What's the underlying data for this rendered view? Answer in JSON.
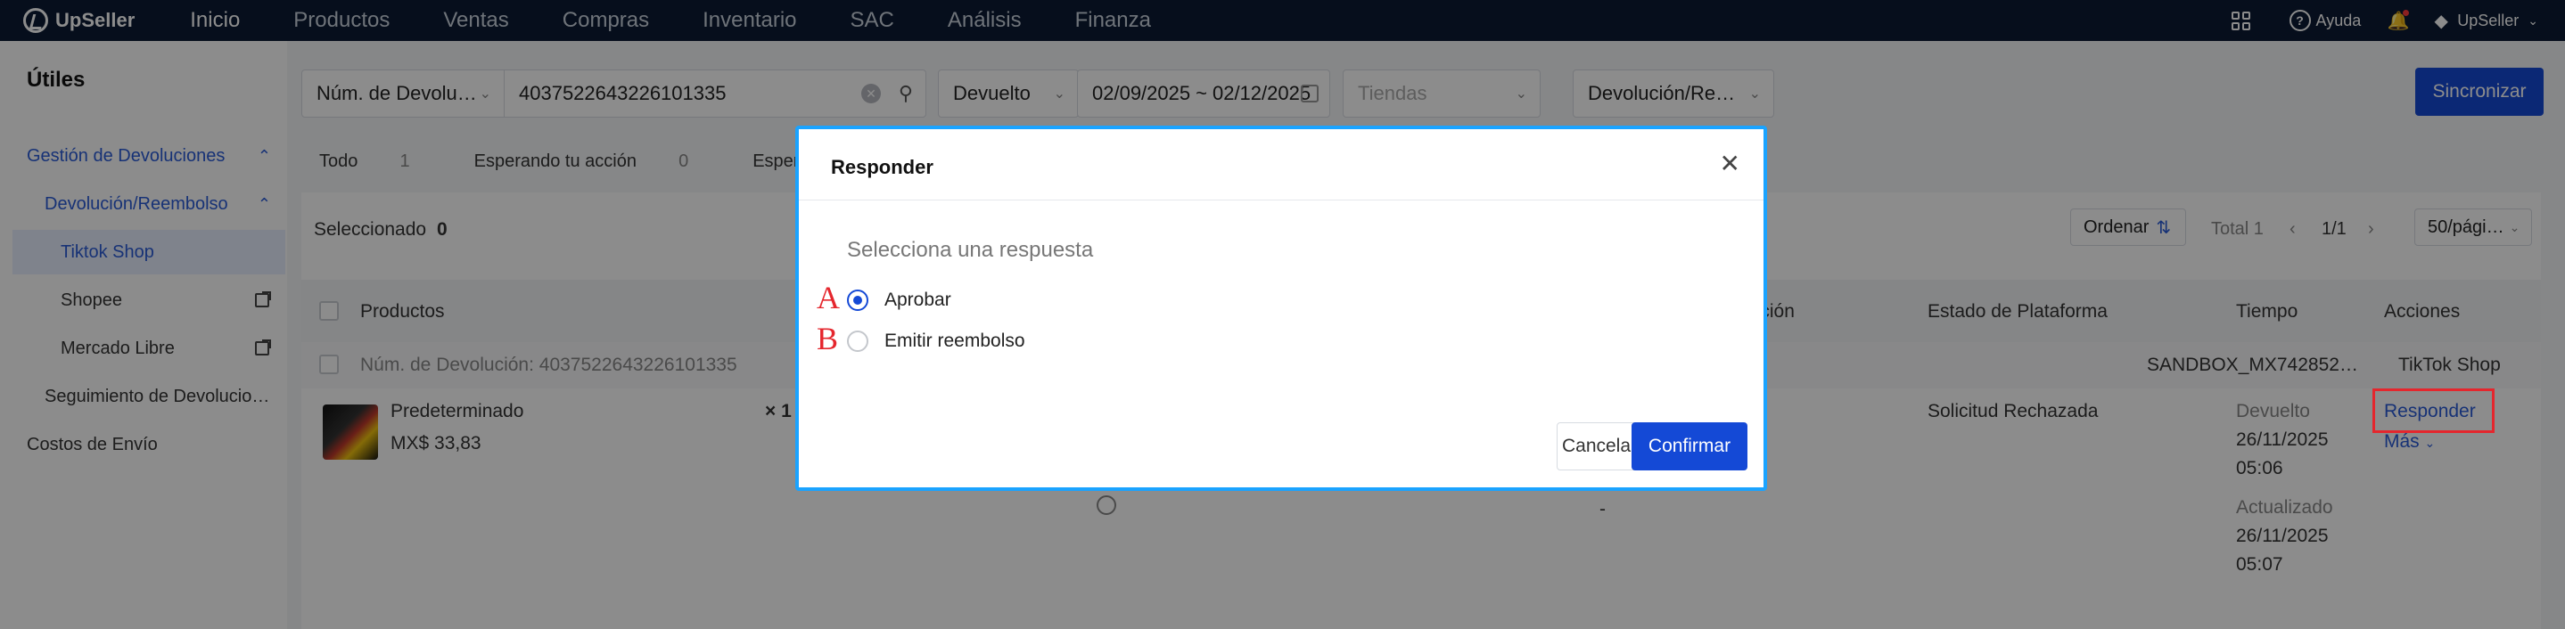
{
  "topbar": {
    "brand": "UpSeller",
    "nav": [
      "Inicio",
      "Productos",
      "Ventas",
      "Compras",
      "Inventario",
      "SAC",
      "Análisis",
      "Finanza"
    ],
    "help": "Ayuda",
    "account": "UpSeller"
  },
  "sidebar": {
    "title": "Útiles",
    "items": [
      {
        "label": "Gestión de Devoluciones"
      },
      {
        "label": "Devolución/Reembolso"
      },
      {
        "label": "Tiktok Shop"
      },
      {
        "label": "Shopee"
      },
      {
        "label": "Mercado Libre"
      },
      {
        "label": "Seguimiento de Devolucio…"
      },
      {
        "label": "Costos de Envío"
      }
    ]
  },
  "filters": {
    "search_type": "Núm. de Devolu…",
    "search_value": "4037522643226101335",
    "status": "Devuelto",
    "date_from": "02/09/2025",
    "date_sep": "~",
    "date_to": "02/12/2025",
    "stores_placeholder": "Tiendas",
    "type": "Devolución/Re…",
    "sync_button": "Sincronizar"
  },
  "status_tabs": [
    {
      "label": "Todo",
      "count": "1"
    },
    {
      "label": "Esperando tu acción",
      "count": "0"
    },
    {
      "label": "Esperando acción del",
      "count": ""
    }
  ],
  "table": {
    "selected_label": "Seleccionado",
    "selected_count": "0",
    "sort_label": "Ordenar",
    "total": "Total 1",
    "page": "1/1",
    "page_size": "50/pági…",
    "headers": {
      "products": "Productos",
      "resolution": "lución",
      "platform_status": "Estado de Plataforma",
      "time": "Tiempo",
      "actions": "Acciones"
    },
    "order_row": {
      "return_no": "Núm. de Devolución: 4037522643226101335",
      "store": "SANDBOX_MX742852…",
      "platform": "TikTok Shop"
    },
    "item": {
      "name": "Predeterminado",
      "price": "MX$ 33,83",
      "qty": "× 1",
      "platform_status": "Solicitud Rechazada",
      "dash": "-",
      "returned_label": "Devuelto",
      "returned_date": "26/11/2025",
      "returned_time": "05:06",
      "updated_label": "Actualizado",
      "updated_date": "26/11/2025",
      "updated_time": "05:07",
      "action_primary": "Responder",
      "action_more": "Más"
    }
  },
  "modal": {
    "title": "Responder",
    "subtitle": "Selecciona una respuesta",
    "options": [
      {
        "marker": "A",
        "label": "Aprobar",
        "selected": true
      },
      {
        "marker": "B",
        "label": "Emitir reembolso",
        "selected": false
      }
    ],
    "cancel": "Cancelar",
    "confirm": "Confirmar"
  }
}
